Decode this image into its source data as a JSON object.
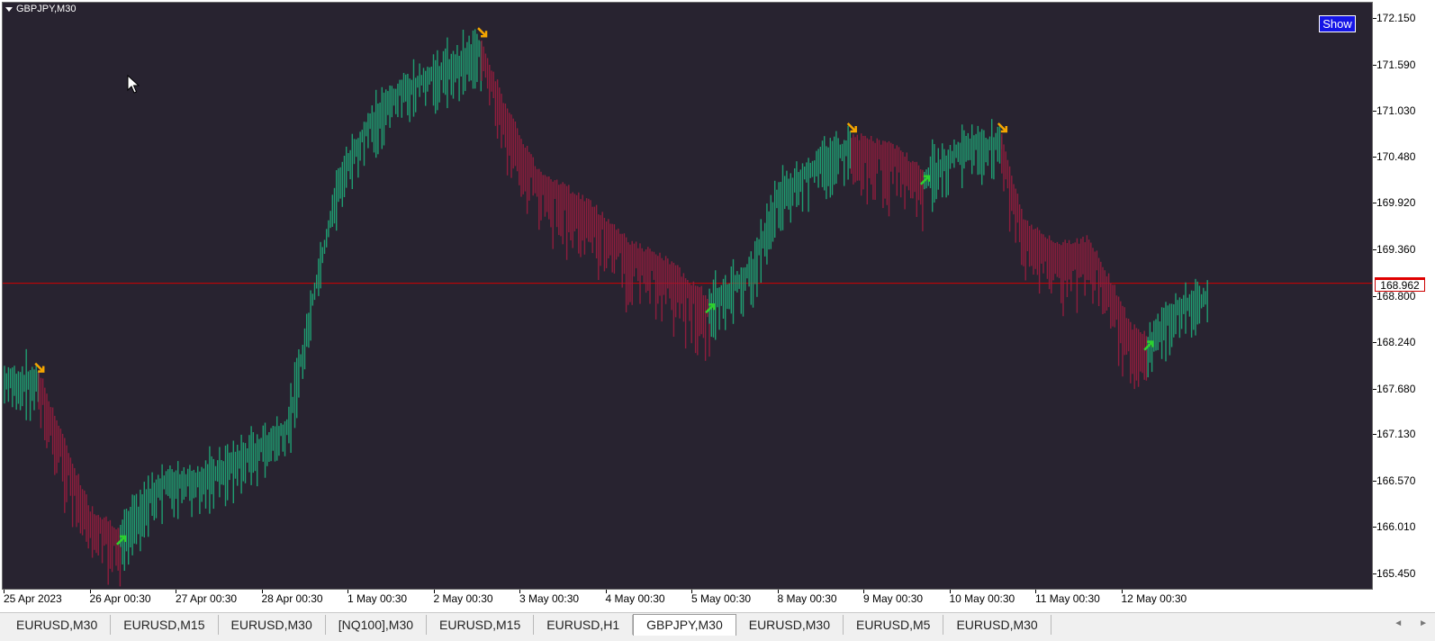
{
  "window": {
    "symbol_label": "GBPJPY,M30",
    "show_button": "Show",
    "current_price": "168.962",
    "current_price_value": 168.962
  },
  "icons": {
    "symbol_menu": "triangle-down-icon",
    "cursor": "mouse-pointer-icon",
    "sell_signal": "arrow-down-right-icon",
    "buy_signal": "arrow-up-right-icon",
    "scroll_left": "chevron-left-icon",
    "scroll_right": "chevron-right-icon"
  },
  "colors": {
    "background": "#282330",
    "bullish": "#1f9e72",
    "bearish": "#8f1d3d",
    "sell_arrow": "#f5a600",
    "buy_arrow": "#2ed12e",
    "price_line": "#d40000",
    "show_button": "#1515e6"
  },
  "chart_data": {
    "type": "candlestick-indicator",
    "instrument": "GBPJPY",
    "timeframe": "M30",
    "ylim": [
      165.25,
      172.35
    ],
    "y_ticks": [
      "172.150",
      "171.590",
      "171.030",
      "170.480",
      "169.920",
      "169.360",
      "168.800",
      "168.240",
      "167.680",
      "167.130",
      "166.570",
      "166.010",
      "165.450"
    ],
    "x_ticks": [
      "25 Apr 2023",
      "26 Apr 00:30",
      "27 Apr 00:30",
      "28 Apr 00:30",
      "1 May 00:30",
      "2 May 00:30",
      "3 May 00:30",
      "4 May 00:30",
      "5 May 00:30",
      "8 May 00:30",
      "9 May 00:30",
      "10 May 00:30",
      "11 May 00:30",
      "12 May 00:30"
    ],
    "segments": [
      {
        "trend": "up",
        "start": 0.0,
        "end": 0.4,
        "points": [
          [
            0.0,
            167.85
          ],
          [
            0.4,
            167.85
          ]
        ]
      },
      {
        "trend": "down",
        "start": 0.4,
        "end": 1.35,
        "points": [
          [
            0.4,
            167.85
          ],
          [
            0.7,
            167.0
          ],
          [
            1.0,
            166.2
          ],
          [
            1.35,
            165.95
          ]
        ]
      },
      {
        "trend": "up",
        "start": 1.35,
        "end": 5.55,
        "points": [
          [
            1.35,
            165.95
          ],
          [
            1.8,
            166.6
          ],
          [
            2.4,
            166.7
          ],
          [
            2.9,
            167.0
          ],
          [
            3.3,
            167.3
          ],
          [
            3.6,
            168.9
          ],
          [
            3.9,
            170.3
          ],
          [
            4.25,
            170.95
          ],
          [
            4.6,
            171.35
          ],
          [
            5.0,
            171.55
          ],
          [
            5.55,
            171.85
          ]
        ]
      },
      {
        "trend": "down",
        "start": 5.55,
        "end": 8.2,
        "points": [
          [
            5.55,
            171.85
          ],
          [
            5.85,
            171.0
          ],
          [
            6.2,
            170.3
          ],
          [
            6.8,
            169.9
          ],
          [
            7.3,
            169.4
          ],
          [
            7.7,
            169.2
          ],
          [
            8.2,
            168.75
          ]
        ]
      },
      {
        "trend": "up",
        "start": 8.2,
        "end": 9.85,
        "points": [
          [
            8.2,
            168.75
          ],
          [
            8.7,
            169.2
          ],
          [
            9.0,
            170.1
          ],
          [
            9.5,
            170.5
          ],
          [
            9.85,
            170.7
          ]
        ]
      },
      {
        "trend": "down",
        "start": 9.85,
        "end": 10.7,
        "points": [
          [
            9.85,
            170.7
          ],
          [
            10.3,
            170.6
          ],
          [
            10.7,
            170.3
          ]
        ]
      },
      {
        "trend": "up",
        "start": 10.7,
        "end": 11.6,
        "points": [
          [
            10.7,
            170.3
          ],
          [
            11.2,
            170.7
          ],
          [
            11.6,
            170.7
          ]
        ]
      },
      {
        "trend": "down",
        "start": 11.6,
        "end": 13.3,
        "points": [
          [
            11.6,
            170.7
          ],
          [
            11.85,
            169.7
          ],
          [
            12.2,
            169.4
          ],
          [
            12.6,
            169.45
          ],
          [
            12.9,
            168.9
          ],
          [
            13.1,
            168.4
          ],
          [
            13.3,
            168.3
          ]
        ]
      },
      {
        "trend": "up",
        "start": 13.3,
        "end": 14.0,
        "points": [
          [
            13.3,
            168.3
          ],
          [
            13.6,
            168.7
          ],
          [
            14.0,
            168.85
          ]
        ]
      }
    ],
    "signals": [
      {
        "type": "sell",
        "x": 0.4,
        "price": 167.95
      },
      {
        "type": "buy",
        "x": 1.35,
        "price": 165.85
      },
      {
        "type": "sell",
        "x": 5.55,
        "price": 172.0
      },
      {
        "type": "buy",
        "x": 8.2,
        "price": 168.65
      },
      {
        "type": "sell",
        "x": 9.85,
        "price": 170.85
      },
      {
        "type": "buy",
        "x": 10.7,
        "price": 170.2
      },
      {
        "type": "sell",
        "x": 11.6,
        "price": 170.85
      },
      {
        "type": "buy",
        "x": 13.3,
        "price": 168.2
      }
    ]
  },
  "tabs": [
    {
      "label": "EURUSD,M30"
    },
    {
      "label": "EURUSD,M15"
    },
    {
      "label": "EURUSD,M30"
    },
    {
      "label": "[NQ100],M30"
    },
    {
      "label": "EURUSD,M15"
    },
    {
      "label": "EURUSD,H1"
    },
    {
      "label": "GBPJPY,M30",
      "active": true
    },
    {
      "label": "EURUSD,M30"
    },
    {
      "label": "EURUSD,M5"
    },
    {
      "label": "EURUSD,M30"
    }
  ],
  "tab_scroll": {
    "left": "◄",
    "right": "►"
  }
}
